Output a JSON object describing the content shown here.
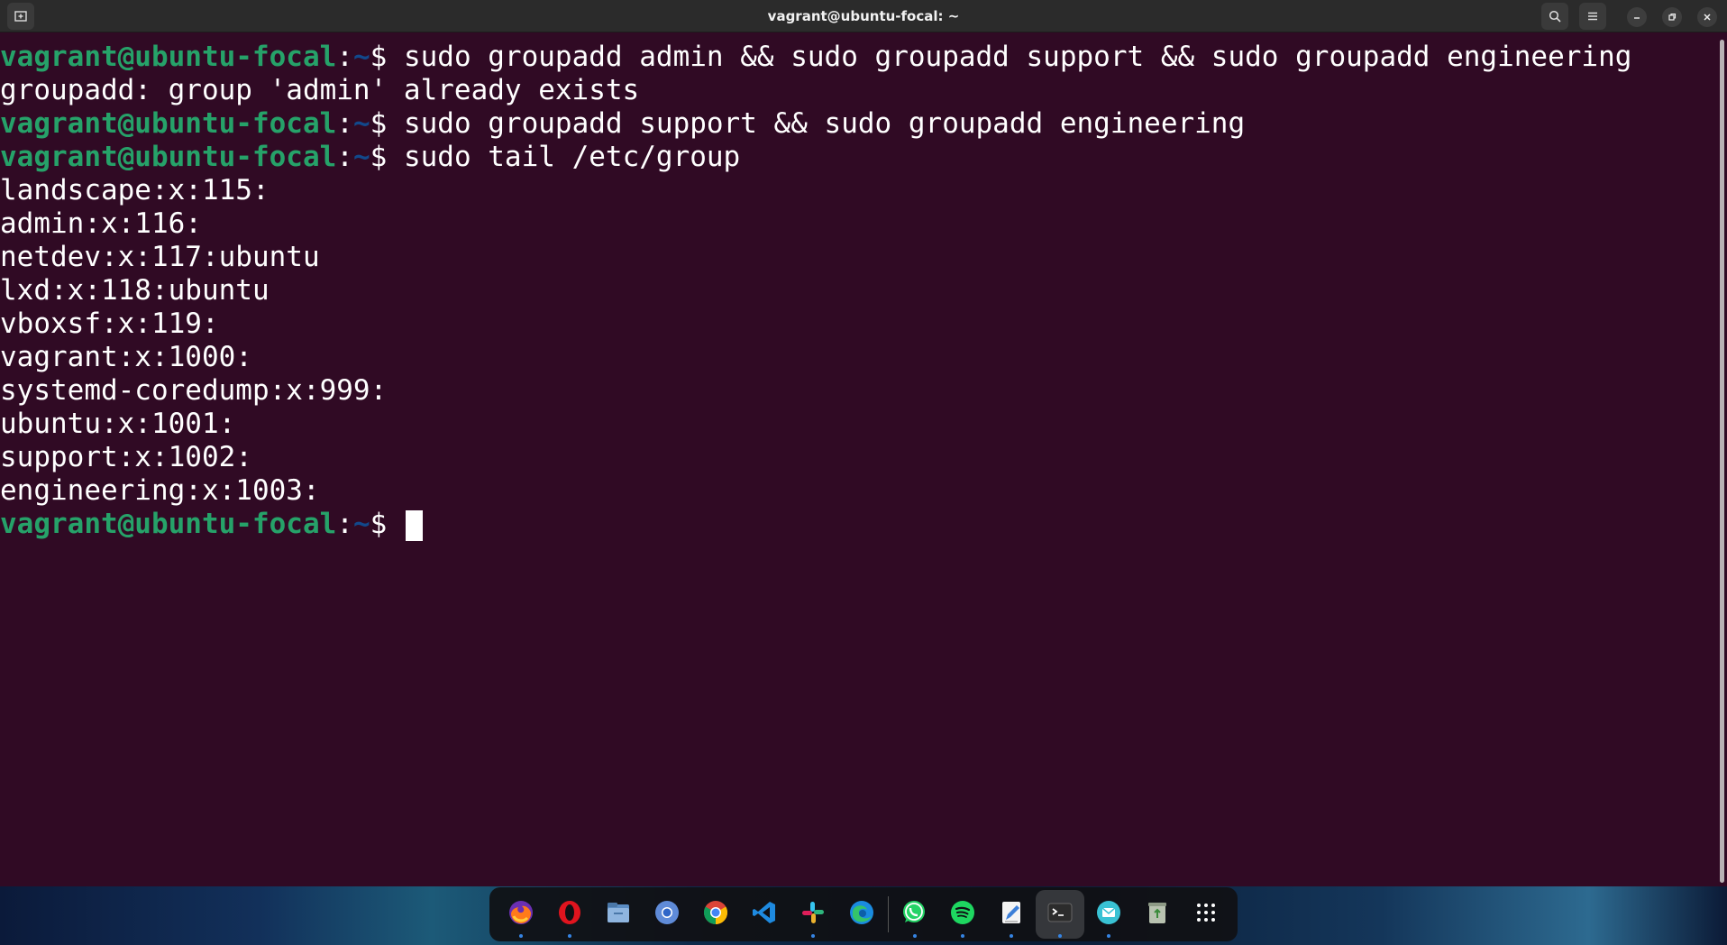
{
  "window": {
    "title": "vagrant@ubuntu-focal: ~"
  },
  "prompt": {
    "user_host": "vagrant@ubuntu-focal",
    "path": "~",
    "symbol": "$ "
  },
  "terminal": {
    "lines": [
      {
        "type": "prompt",
        "command": "sudo groupadd admin && sudo groupadd support && sudo groupadd engineering"
      },
      {
        "type": "output",
        "text": "groupadd: group 'admin' already exists"
      },
      {
        "type": "prompt",
        "command": "sudo groupadd support && sudo groupadd engineering"
      },
      {
        "type": "prompt",
        "command": "sudo tail /etc/group"
      },
      {
        "type": "output",
        "text": "landscape:x:115:"
      },
      {
        "type": "output",
        "text": "admin:x:116:"
      },
      {
        "type": "output",
        "text": "netdev:x:117:ubuntu"
      },
      {
        "type": "output",
        "text": "lxd:x:118:ubuntu"
      },
      {
        "type": "output",
        "text": "vboxsf:x:119:"
      },
      {
        "type": "output",
        "text": "vagrant:x:1000:"
      },
      {
        "type": "output",
        "text": "systemd-coredump:x:999:"
      },
      {
        "type": "output",
        "text": "ubuntu:x:1001:"
      },
      {
        "type": "output",
        "text": "support:x:1002:"
      },
      {
        "type": "output",
        "text": "engineering:x:1003:"
      },
      {
        "type": "prompt",
        "command": "",
        "cursor": true
      }
    ]
  },
  "dock": {
    "items": [
      {
        "name": "firefox-icon",
        "running": true
      },
      {
        "name": "opera-icon",
        "running": true
      },
      {
        "name": "files-icon",
        "running": false
      },
      {
        "name": "chromium-icon",
        "running": false
      },
      {
        "name": "chrome-icon",
        "running": false
      },
      {
        "name": "vscode-icon",
        "running": false
      },
      {
        "name": "slack-icon",
        "running": true
      },
      {
        "name": "edge-icon",
        "running": false
      },
      {
        "name": "whatsapp-icon",
        "running": true
      },
      {
        "name": "spotify-icon",
        "running": true
      },
      {
        "name": "text-editor-icon",
        "running": true
      },
      {
        "name": "terminal-icon",
        "running": true,
        "active": true
      },
      {
        "name": "mail-icon",
        "running": true
      },
      {
        "name": "trash-icon",
        "running": false
      },
      {
        "name": "app-grid-icon",
        "running": false
      }
    ]
  },
  "colors": {
    "terminal_bg": "#300a24",
    "prompt_user": "#26a269",
    "prompt_path": "#12488b",
    "text": "#ffffff"
  }
}
